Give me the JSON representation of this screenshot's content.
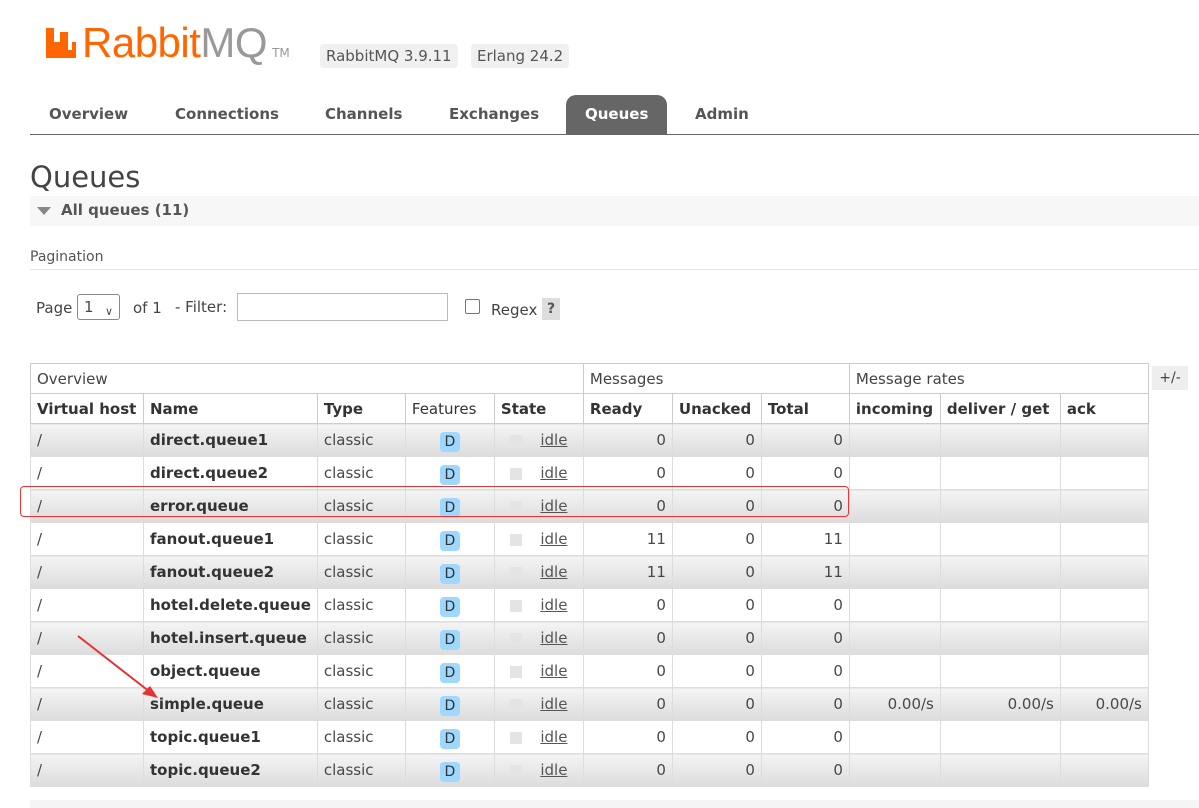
{
  "brand": {
    "name_part1": "Rabbit",
    "name_part2": "MQ",
    "tm": "TM",
    "logo_icon": "rabbitmq-logo-icon"
  },
  "versions": {
    "rabbitmq": "RabbitMQ 3.9.11",
    "erlang": "Erlang 24.2"
  },
  "tabs": [
    {
      "label": "Overview"
    },
    {
      "label": "Connections"
    },
    {
      "label": "Channels"
    },
    {
      "label": "Exchanges"
    },
    {
      "label": "Queues",
      "active": true
    },
    {
      "label": "Admin"
    }
  ],
  "page": {
    "title": "Queues",
    "section_label": "All queues (11)"
  },
  "pagination": {
    "label": "Pagination",
    "page_label": "Page",
    "page_value": "1",
    "of_label": "of 1",
    "filter_label": "- Filter:",
    "filter_value": "",
    "regex_label": "Regex",
    "help_label": "?"
  },
  "table": {
    "groups": [
      "Overview",
      "Messages",
      "Message rates"
    ],
    "columns": [
      "Virtual host",
      "Name",
      "Type",
      "Features",
      "State",
      "Ready",
      "Unacked",
      "Total",
      "incoming",
      "deliver / get",
      "ack"
    ],
    "toggle_label": "+/-",
    "rows": [
      {
        "vhost": "/",
        "name": "direct.queue1",
        "type": "classic",
        "feature": "D",
        "state": "idle",
        "ready": "0",
        "unacked": "0",
        "total": "0",
        "incoming": "",
        "deliver": "",
        "ack": ""
      },
      {
        "vhost": "/",
        "name": "direct.queue2",
        "type": "classic",
        "feature": "D",
        "state": "idle",
        "ready": "0",
        "unacked": "0",
        "total": "0",
        "incoming": "",
        "deliver": "",
        "ack": ""
      },
      {
        "vhost": "/",
        "name": "error.queue",
        "type": "classic",
        "feature": "D",
        "state": "idle",
        "ready": "0",
        "unacked": "0",
        "total": "0",
        "incoming": "",
        "deliver": "",
        "ack": ""
      },
      {
        "vhost": "/",
        "name": "fanout.queue1",
        "type": "classic",
        "feature": "D",
        "state": "idle",
        "ready": "11",
        "unacked": "0",
        "total": "11",
        "incoming": "",
        "deliver": "",
        "ack": ""
      },
      {
        "vhost": "/",
        "name": "fanout.queue2",
        "type": "classic",
        "feature": "D",
        "state": "idle",
        "ready": "11",
        "unacked": "0",
        "total": "11",
        "incoming": "",
        "deliver": "",
        "ack": ""
      },
      {
        "vhost": "/",
        "name": "hotel.delete.queue",
        "type": "classic",
        "feature": "D",
        "state": "idle",
        "ready": "0",
        "unacked": "0",
        "total": "0",
        "incoming": "",
        "deliver": "",
        "ack": ""
      },
      {
        "vhost": "/",
        "name": "hotel.insert.queue",
        "type": "classic",
        "feature": "D",
        "state": "idle",
        "ready": "0",
        "unacked": "0",
        "total": "0",
        "incoming": "",
        "deliver": "",
        "ack": ""
      },
      {
        "vhost": "/",
        "name": "object.queue",
        "type": "classic",
        "feature": "D",
        "state": "idle",
        "ready": "0",
        "unacked": "0",
        "total": "0",
        "incoming": "",
        "deliver": "",
        "ack": ""
      },
      {
        "vhost": "/",
        "name": "simple.queue",
        "type": "classic",
        "feature": "D",
        "state": "idle",
        "ready": "0",
        "unacked": "0",
        "total": "0",
        "incoming": "0.00/s",
        "deliver": "0.00/s",
        "ack": "0.00/s"
      },
      {
        "vhost": "/",
        "name": "topic.queue1",
        "type": "classic",
        "feature": "D",
        "state": "idle",
        "ready": "0",
        "unacked": "0",
        "total": "0",
        "incoming": "",
        "deliver": "",
        "ack": ""
      },
      {
        "vhost": "/",
        "name": "topic.queue2",
        "type": "classic",
        "feature": "D",
        "state": "idle",
        "ready": "0",
        "unacked": "0",
        "total": "0",
        "incoming": "",
        "deliver": "",
        "ack": ""
      }
    ]
  },
  "annotations": {
    "highlight_color": "#e33333",
    "arrow_color": "#e33333"
  },
  "colors": {
    "brand_orange": "#ff6600",
    "active_tab": "#666666",
    "durable_badge": "#9ed8ff"
  }
}
